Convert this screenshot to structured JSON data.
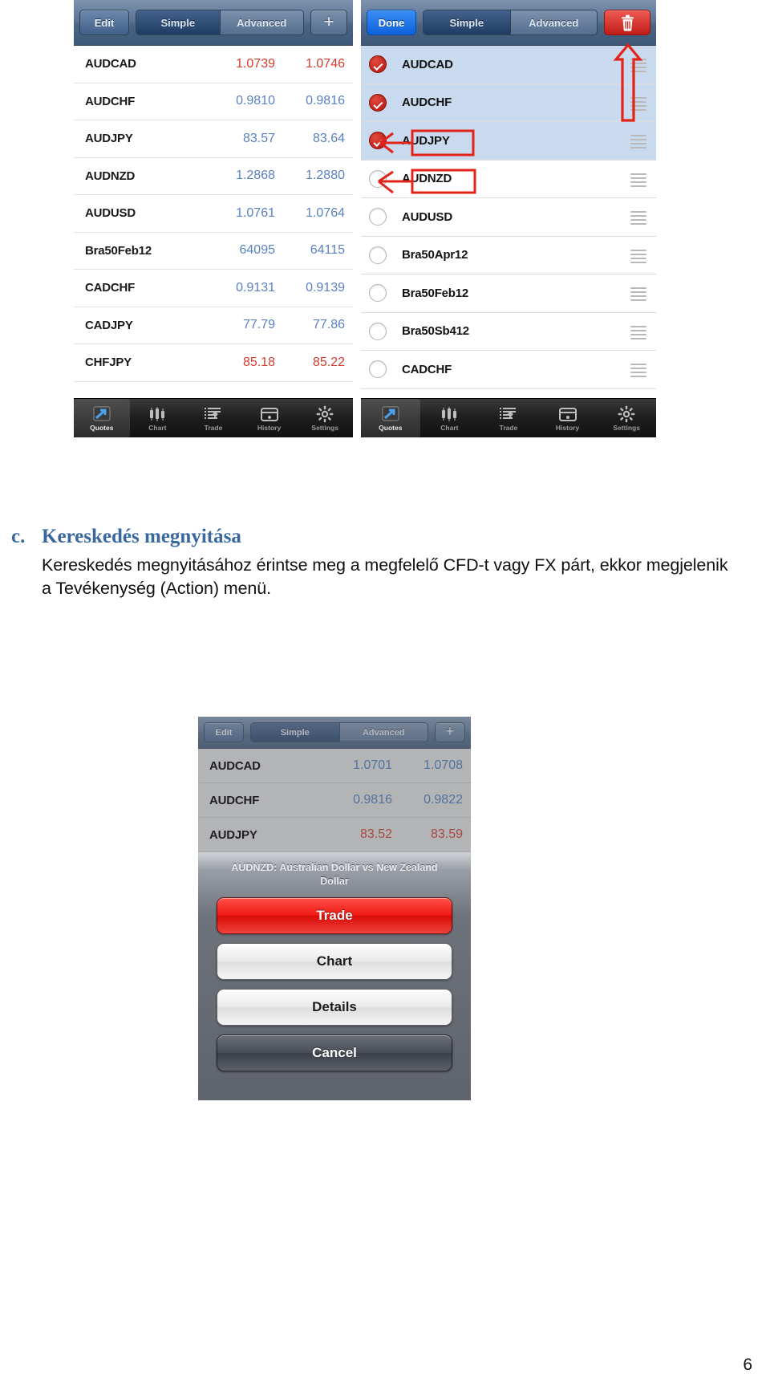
{
  "top_figure": {
    "left_phone": {
      "nav": {
        "edit_label": "Edit",
        "simple_label": "Simple",
        "advanced_label": "Advanced",
        "add_label": "+"
      },
      "quotes": [
        {
          "symbol": "AUDCAD",
          "bid": "1.0739",
          "ask": "1.0746",
          "dir": "down"
        },
        {
          "symbol": "AUDCHF",
          "bid": "0.9810",
          "ask": "0.9816",
          "dir": "up"
        },
        {
          "symbol": "AUDJPY",
          "bid": "83.57",
          "ask": "83.64",
          "dir": "up"
        },
        {
          "symbol": "AUDNZD",
          "bid": "1.2868",
          "ask": "1.2880",
          "dir": "up"
        },
        {
          "symbol": "AUDUSD",
          "bid": "1.0761",
          "ask": "1.0764",
          "dir": "up"
        },
        {
          "symbol": "Bra50Feb12",
          "bid": "64095",
          "ask": "64115",
          "dir": "up"
        },
        {
          "symbol": "CADCHF",
          "bid": "0.9131",
          "ask": "0.9139",
          "dir": "up"
        },
        {
          "symbol": "CADJPY",
          "bid": "77.79",
          "ask": "77.86",
          "dir": "up"
        },
        {
          "symbol": "CHFJPY",
          "bid": "85.18",
          "ask": "85.22",
          "dir": "down"
        }
      ],
      "tabs": [
        {
          "label": "Quotes",
          "icon": "quotes-icon",
          "active": true
        },
        {
          "label": "Chart",
          "icon": "chart-icon",
          "active": false
        },
        {
          "label": "Trade",
          "icon": "trade-icon",
          "active": false
        },
        {
          "label": "History",
          "icon": "history-icon",
          "active": false
        },
        {
          "label": "Settings",
          "icon": "settings-icon",
          "active": false
        }
      ]
    },
    "right_phone": {
      "nav": {
        "done_label": "Done",
        "simple_label": "Simple",
        "advanced_label": "Advanced",
        "delete_label": "trash-icon"
      },
      "symbols": [
        {
          "name": "AUDCAD",
          "checked": true,
          "selected": true
        },
        {
          "name": "AUDCHF",
          "checked": true,
          "selected": true
        },
        {
          "name": "AUDJPY",
          "checked": true,
          "selected": true
        },
        {
          "name": "AUDNZD",
          "checked": false,
          "selected": false
        },
        {
          "name": "AUDUSD",
          "checked": false,
          "selected": false
        },
        {
          "name": "Bra50Apr12",
          "checked": false,
          "selected": false
        },
        {
          "name": "Bra50Feb12",
          "checked": false,
          "selected": false
        },
        {
          "name": "Bra50Sb412",
          "checked": false,
          "selected": false
        },
        {
          "name": "CADCHF",
          "checked": false,
          "selected": false
        }
      ],
      "tabs": [
        {
          "label": "Quotes",
          "icon": "quotes-icon",
          "active": true
        },
        {
          "label": "Chart",
          "icon": "chart-icon",
          "active": false
        },
        {
          "label": "Trade",
          "icon": "trade-icon",
          "active": false
        },
        {
          "label": "History",
          "icon": "history-icon",
          "active": false
        },
        {
          "label": "Settings",
          "icon": "settings-icon",
          "active": false
        }
      ],
      "annotations": [
        {
          "name": "up-arrow-annotation",
          "shape": "red-arrow-up"
        },
        {
          "name": "audjpy-arrow-callout",
          "shape": "red-arrow-left-box"
        },
        {
          "name": "audnzd-arrow-callout",
          "shape": "red-arrow-left-box"
        }
      ]
    }
  },
  "section": {
    "letter": "c.",
    "heading": "Kereskedés megnyitása",
    "paragraph": "Kereskedés megnyitásához érintse meg a megfelelő CFD-t vagy FX párt, ekkor megjelenik a Tevékenység (Action) menü."
  },
  "bottom_figure": {
    "nav": {
      "edit_label": "Edit",
      "simple_label": "Simple",
      "advanced_label": "Advanced",
      "add_label": "+"
    },
    "quotes": [
      {
        "symbol": "AUDCAD",
        "bid": "1.0701",
        "ask": "1.0708",
        "dir": "up"
      },
      {
        "symbol": "AUDCHF",
        "bid": "0.9816",
        "ask": "0.9822",
        "dir": "up"
      },
      {
        "symbol": "AUDJPY",
        "bid": "83.52",
        "ask": "83.59",
        "dir": "down"
      }
    ],
    "action_sheet": {
      "title": "AUDNZD: Australian Dollar vs New Zealand Dollar",
      "buttons": [
        {
          "label": "Trade",
          "style": "red"
        },
        {
          "label": "Chart",
          "style": "grey"
        },
        {
          "label": "Details",
          "style": "grey"
        },
        {
          "label": "Cancel",
          "style": "dark"
        }
      ]
    }
  },
  "page_number": "6",
  "colors": {
    "heading": "#39689e",
    "quote_up": "#5a81c0",
    "quote_down": "#d63b2c",
    "annotation": "#e2231a",
    "trade_button": "#e8201a"
  }
}
